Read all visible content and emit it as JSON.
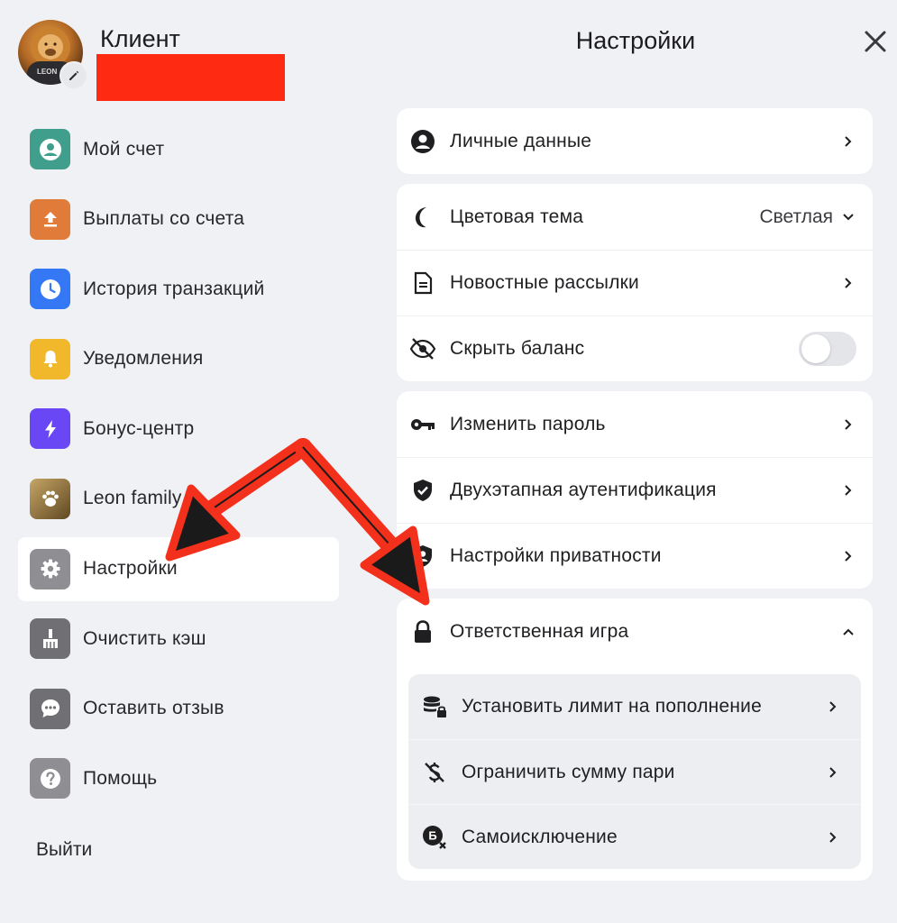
{
  "header": {
    "client_name": "Клиент",
    "title": "Настройки",
    "avatar_text": "LEON",
    "close_icon": "close-icon"
  },
  "sidebar": {
    "items": [
      {
        "label": "Мой счет",
        "icon": "account-icon",
        "color": "#3f9e8c"
      },
      {
        "label": "Выплаты со счета",
        "icon": "withdraw-icon",
        "color": "#e07b39"
      },
      {
        "label": "История транзакций",
        "icon": "clock-icon",
        "color": "#3478f6"
      },
      {
        "label": "Уведомления",
        "icon": "bell-icon",
        "color": "#f2b82c"
      },
      {
        "label": "Бонус-центр",
        "icon": "lightning-icon",
        "color": "#6a47f4"
      },
      {
        "label": "Leon family",
        "icon": "paw-icon",
        "color": "#8a6d3b"
      },
      {
        "label": "Настройки",
        "icon": "gear-icon",
        "color": "#8e8e93",
        "active": true
      },
      {
        "label": "Очистить кэш",
        "icon": "broom-icon",
        "color": "#6f6f74"
      },
      {
        "label": "Оставить отзыв",
        "icon": "chat-icon",
        "color": "#6f6f74"
      },
      {
        "label": "Помощь",
        "icon": "help-icon",
        "color": "#8e8e93"
      }
    ],
    "logout_label": "Выйти"
  },
  "settings": {
    "personal": {
      "label": "Личные данные"
    },
    "theme": {
      "label": "Цветовая тема",
      "value": "Светлая"
    },
    "newsletter": {
      "label": "Новостные рассылки"
    },
    "hide_balance": {
      "label": "Скрыть баланс",
      "enabled": false
    },
    "password": {
      "label": "Изменить пароль"
    },
    "two_factor": {
      "label": "Двухэтапная аутентификация"
    },
    "privacy": {
      "label": "Настройки приватности"
    },
    "responsible": {
      "label": "Ответственная игра",
      "expanded": true,
      "items": [
        {
          "label": "Установить лимит на пополнение",
          "icon": "coins-lock-icon"
        },
        {
          "label": "Ограничить сумму пари",
          "icon": "no-dollar-icon"
        },
        {
          "label": "Самоисключение",
          "icon": "self-exclusion-icon"
        }
      ]
    }
  },
  "colors": {
    "background": "#f0f1f4",
    "card": "#ffffff",
    "annotation_arrow": "#f2301b",
    "redaction": "#ff2a12"
  }
}
